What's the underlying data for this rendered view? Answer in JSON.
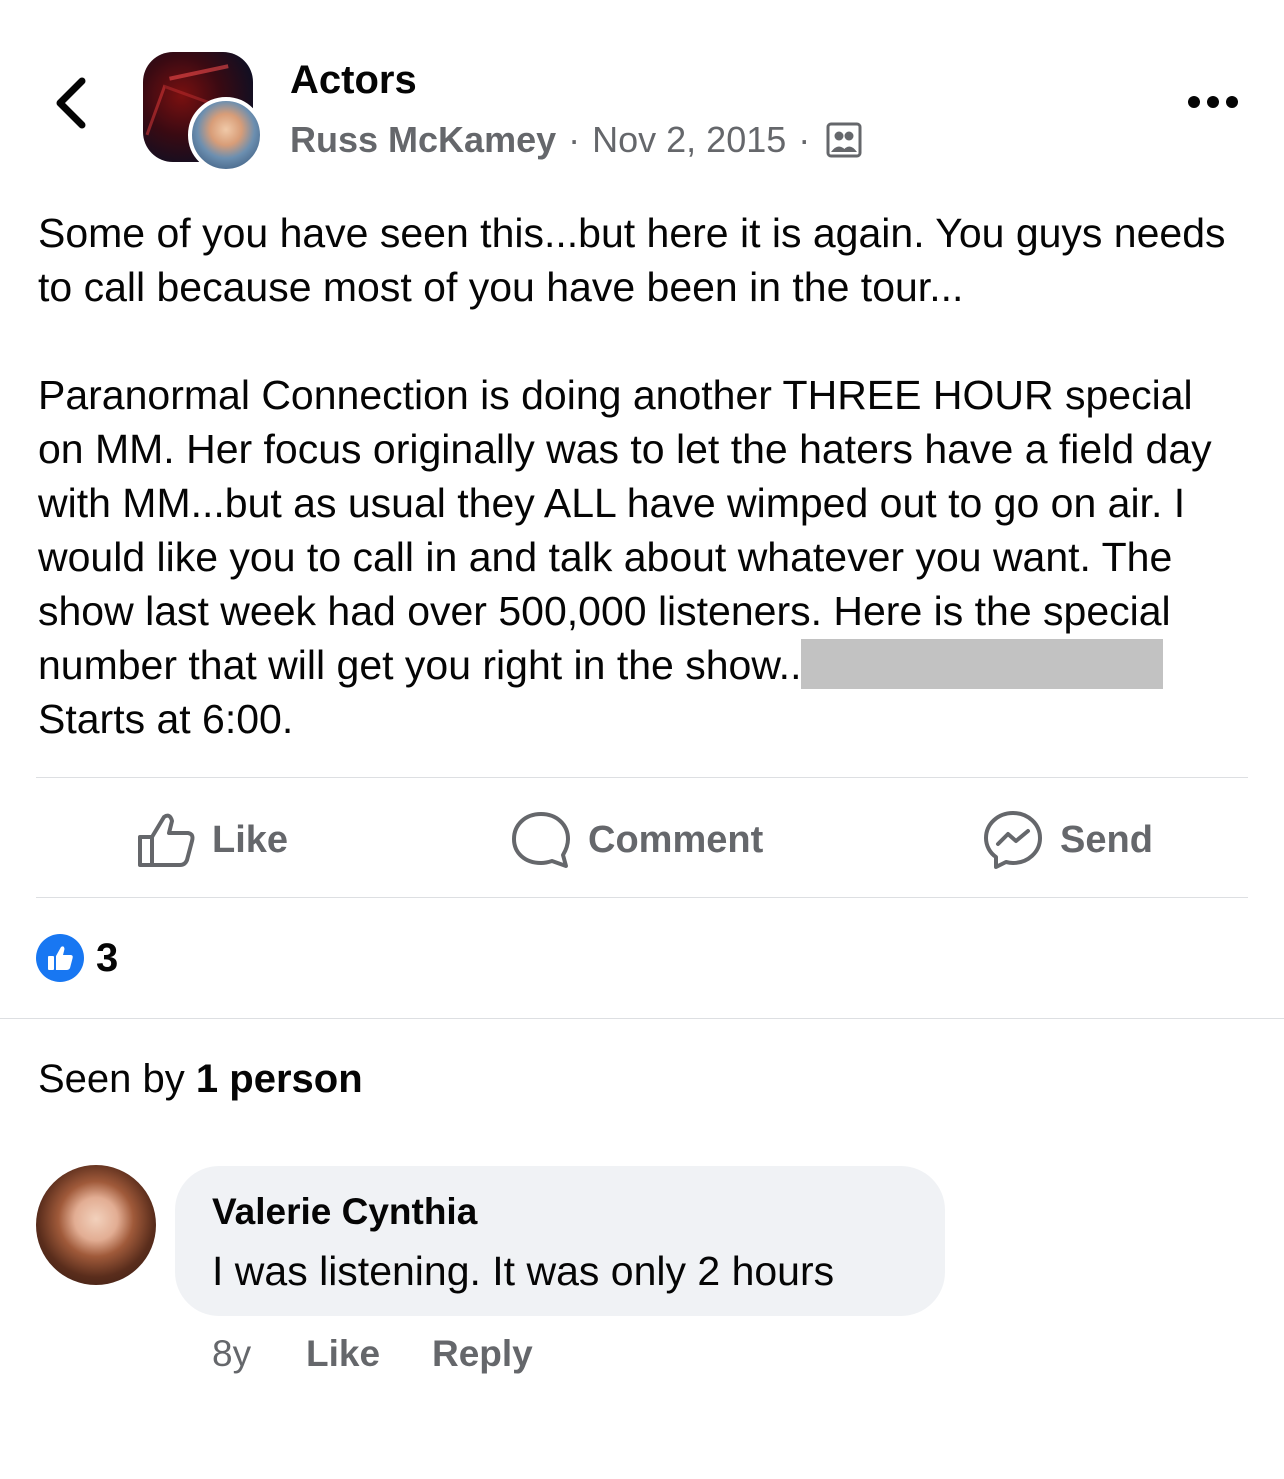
{
  "header": {
    "group_name": "Actors",
    "author": "Russ McKamey",
    "separator": "·",
    "date": "Nov 2, 2015",
    "audience_icon": "group-members-icon",
    "back_icon": "chevron-left-icon",
    "more_icon": "more-dots-icon"
  },
  "post": {
    "paragraph1": "Some of you have seen this...but here it is again. You guys needs to call because most of you have been in the tour...",
    "paragraph2": "Paranormal Connection is doing another THREE HOUR special on MM. Her focus originally was to let the haters have a field day with MM...but as usual they ALL have wimped out to go on air.  I would like you to call in and talk about whatever you want. The show last week had over 500,000 listeners. Here is the special number that will get you right in the show..",
    "paragraph2_end": "Starts at 6:00."
  },
  "actions": {
    "like_label": "Like",
    "comment_label": "Comment",
    "send_label": "Send"
  },
  "reactions": {
    "count": "3",
    "icon": "thumbs-up-icon",
    "color": "#1877f2"
  },
  "seen": {
    "prefix": "Seen by",
    "count_text": "1 person"
  },
  "comment": {
    "author": "Valerie Cynthia",
    "text": "I was listening. It was only 2 hours",
    "time": "8y",
    "like_label": "Like",
    "reply_label": "Reply"
  },
  "colors": {
    "text_primary": "#050505",
    "text_secondary": "#65676b",
    "accent": "#1877f2",
    "bubble": "#f0f2f5",
    "divider": "#dddfe2"
  }
}
